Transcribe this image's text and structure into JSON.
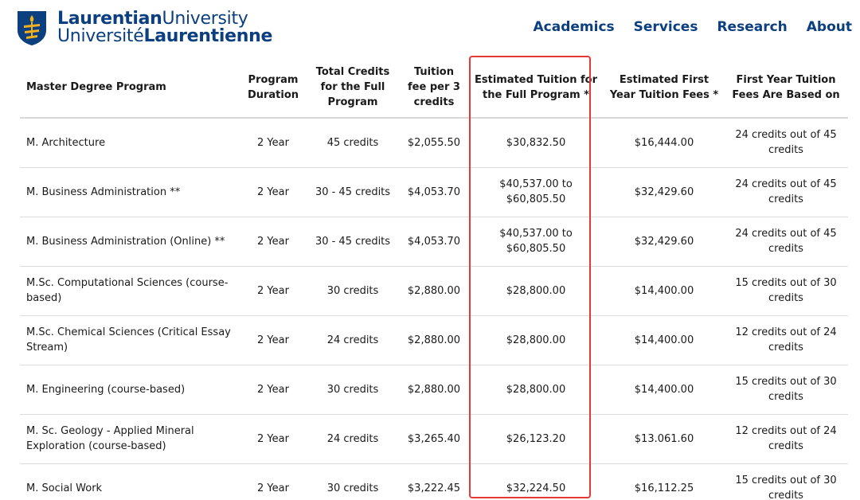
{
  "header": {
    "logo_line1_bold": "Laurentian",
    "logo_line1_normal": "University",
    "logo_line2_normal": "Université",
    "logo_line2_bold": "Laurentienne",
    "nav": [
      "Academics",
      "Services",
      "Research",
      "About"
    ]
  },
  "table": {
    "headers": [
      "Master Degree Program",
      "Program Duration",
      "Total Credits for the Full Program",
      "Tuition fee per 3 credits",
      "Estimated Tuition for the Full Program *",
      "Estimated First Year Tuition Fees *",
      "First Year Tuition Fees Are Based on"
    ],
    "rows": [
      [
        "M. Architecture",
        "2 Year",
        "45 credits",
        "$2,055.50",
        "$30,832.50",
        "$16,444.00",
        "24 credits out of 45 credits"
      ],
      [
        "M. Business Administration **",
        "2 Year",
        "30 - 45 credits",
        "$4,053.70",
        "$40,537.00 to $60,805.50",
        "$32,429.60",
        "24 credits out of 45 credits"
      ],
      [
        "M. Business Administration  (Online) **",
        "2 Year",
        "30 - 45 credits",
        "$4,053.70",
        "$40,537.00 to $60,805.50",
        "$32,429.60",
        "24 credits out of 45 credits"
      ],
      [
        "M.Sc. Computational Sciences (course-based)",
        "2 Year",
        "30 credits",
        "$2,880.00",
        "$28,800.00",
        "$14,400.00",
        "15 credits out of 30 credits"
      ],
      [
        "M.Sc. Chemical Sciences (Critical Essay Stream)",
        "2 Year",
        "24 credits",
        "$2,880.00",
        "$28,800.00",
        "$14,400.00",
        "12 credits out of 24 credits"
      ],
      [
        "M. Engineering (course-based)",
        "2 Year",
        "30 credits",
        "$2,880.00",
        "$28,800.00",
        "$14,400.00",
        "15 credits out of 30 credits"
      ],
      [
        "M. Sc. Geology - Applied Mineral Exploration (course-based)",
        "2 Year",
        "24 credits",
        "$3,265.40",
        "$26,123.20",
        "$13.061.60",
        "12 credits out of 24 credits"
      ],
      [
        "M. Social Work",
        "2 Year",
        "30 credits",
        "$3,222.45",
        "$32,224.50",
        "$16,112.25",
        "15 credits out of 30 credits"
      ]
    ]
  },
  "colors": {
    "brand_blue": "#0b3f7f",
    "highlight_red": "#e53935",
    "logo_gold": "#f2b11d"
  },
  "icons": {
    "logo": "laurentian-shield-icon"
  }
}
